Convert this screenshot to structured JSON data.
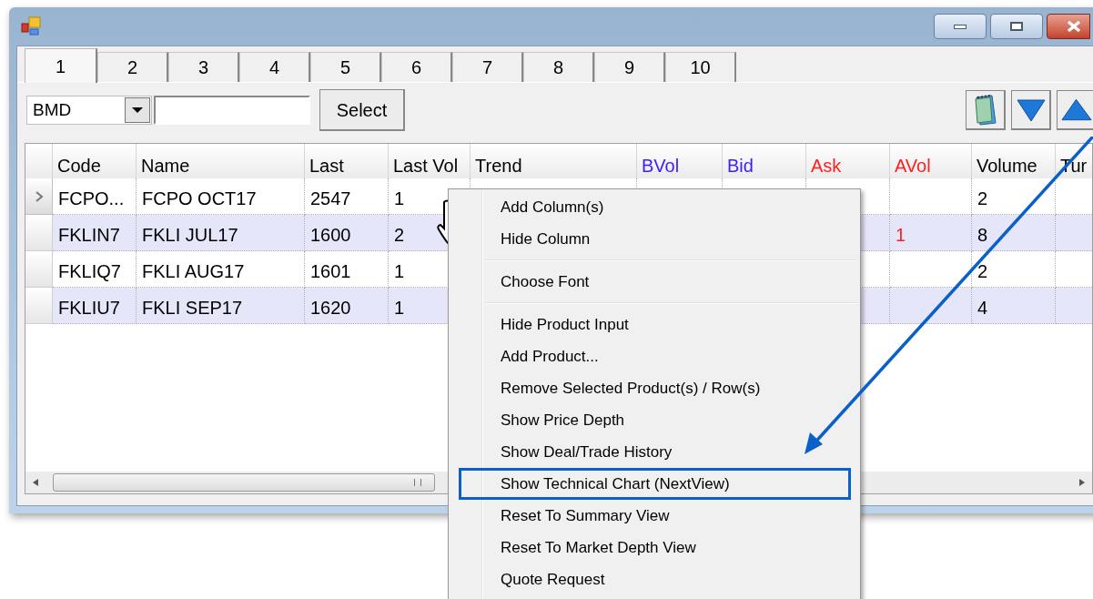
{
  "tabs": [
    {
      "label": "1",
      "selected": true
    },
    {
      "label": "2",
      "selected": false
    },
    {
      "label": "3",
      "selected": false
    },
    {
      "label": "4",
      "selected": false
    },
    {
      "label": "5",
      "selected": false
    },
    {
      "label": "6",
      "selected": false
    },
    {
      "label": "7",
      "selected": false
    },
    {
      "label": "8",
      "selected": false
    },
    {
      "label": "9",
      "selected": false
    },
    {
      "label": "10",
      "selected": false
    }
  ],
  "product_input": {
    "exchange": "BMD",
    "button": "Select"
  },
  "columns": [
    {
      "label": "Code",
      "color": "#000000"
    },
    {
      "label": "Name",
      "color": "#000000"
    },
    {
      "label": "Last",
      "color": "#000000"
    },
    {
      "label": "Last Vol",
      "color": "#000000"
    },
    {
      "label": "Trend",
      "color": "#000000"
    },
    {
      "label": "BVol",
      "color": "#3b1cff"
    },
    {
      "label": "Bid",
      "color": "#3b1cff"
    },
    {
      "label": "Ask",
      "color": "#ff2020"
    },
    {
      "label": "AVol",
      "color": "#ff2020"
    },
    {
      "label": "Volume",
      "color": "#000000"
    },
    {
      "label": "Tur",
      "color": "#000000"
    }
  ],
  "rows": [
    {
      "current": true,
      "cells": [
        "FCPO...",
        "FCPO OCT17",
        "2547",
        "1",
        null,
        null,
        null,
        null,
        null,
        "2",
        null
      ]
    },
    {
      "current": false,
      "cells": [
        "FKLIN7",
        "FKLI JUL17",
        "1600",
        "2",
        null,
        null,
        null,
        null,
        "1",
        "8",
        null
      ]
    },
    {
      "current": false,
      "cells": [
        "FKLIQ7",
        "FKLI AUG17",
        "1601",
        "1",
        null,
        null,
        null,
        null,
        null,
        "2",
        null
      ]
    },
    {
      "current": false,
      "cells": [
        "FKLIU7",
        "FKLI SEP17",
        "1620",
        "1",
        null,
        null,
        null,
        null,
        null,
        "4",
        null
      ]
    }
  ],
  "context_menu": [
    {
      "kind": "item",
      "label": "Add Column(s)",
      "highlighted": false
    },
    {
      "kind": "item",
      "label": "Hide Column",
      "highlighted": false
    },
    {
      "kind": "separator"
    },
    {
      "kind": "item",
      "label": "Choose Font",
      "highlighted": false
    },
    {
      "kind": "separator"
    },
    {
      "kind": "item",
      "label": "Hide Product Input",
      "highlighted": false
    },
    {
      "kind": "item",
      "label": "Add Product...",
      "highlighted": false
    },
    {
      "kind": "item",
      "label": "Remove Selected Product(s) / Row(s)",
      "highlighted": false
    },
    {
      "kind": "item",
      "label": "Show Price Depth",
      "highlighted": false
    },
    {
      "kind": "item",
      "label": "Show Deal/Trade History",
      "highlighted": false
    },
    {
      "kind": "item",
      "label": "Show Technical Chart (NextView)",
      "highlighted": true
    },
    {
      "kind": "item",
      "label": "Reset To Summary View",
      "highlighted": false
    },
    {
      "kind": "item",
      "label": "Reset To Market Depth View",
      "highlighted": false
    },
    {
      "kind": "item",
      "label": "Quote Request",
      "highlighted": false
    }
  ]
}
